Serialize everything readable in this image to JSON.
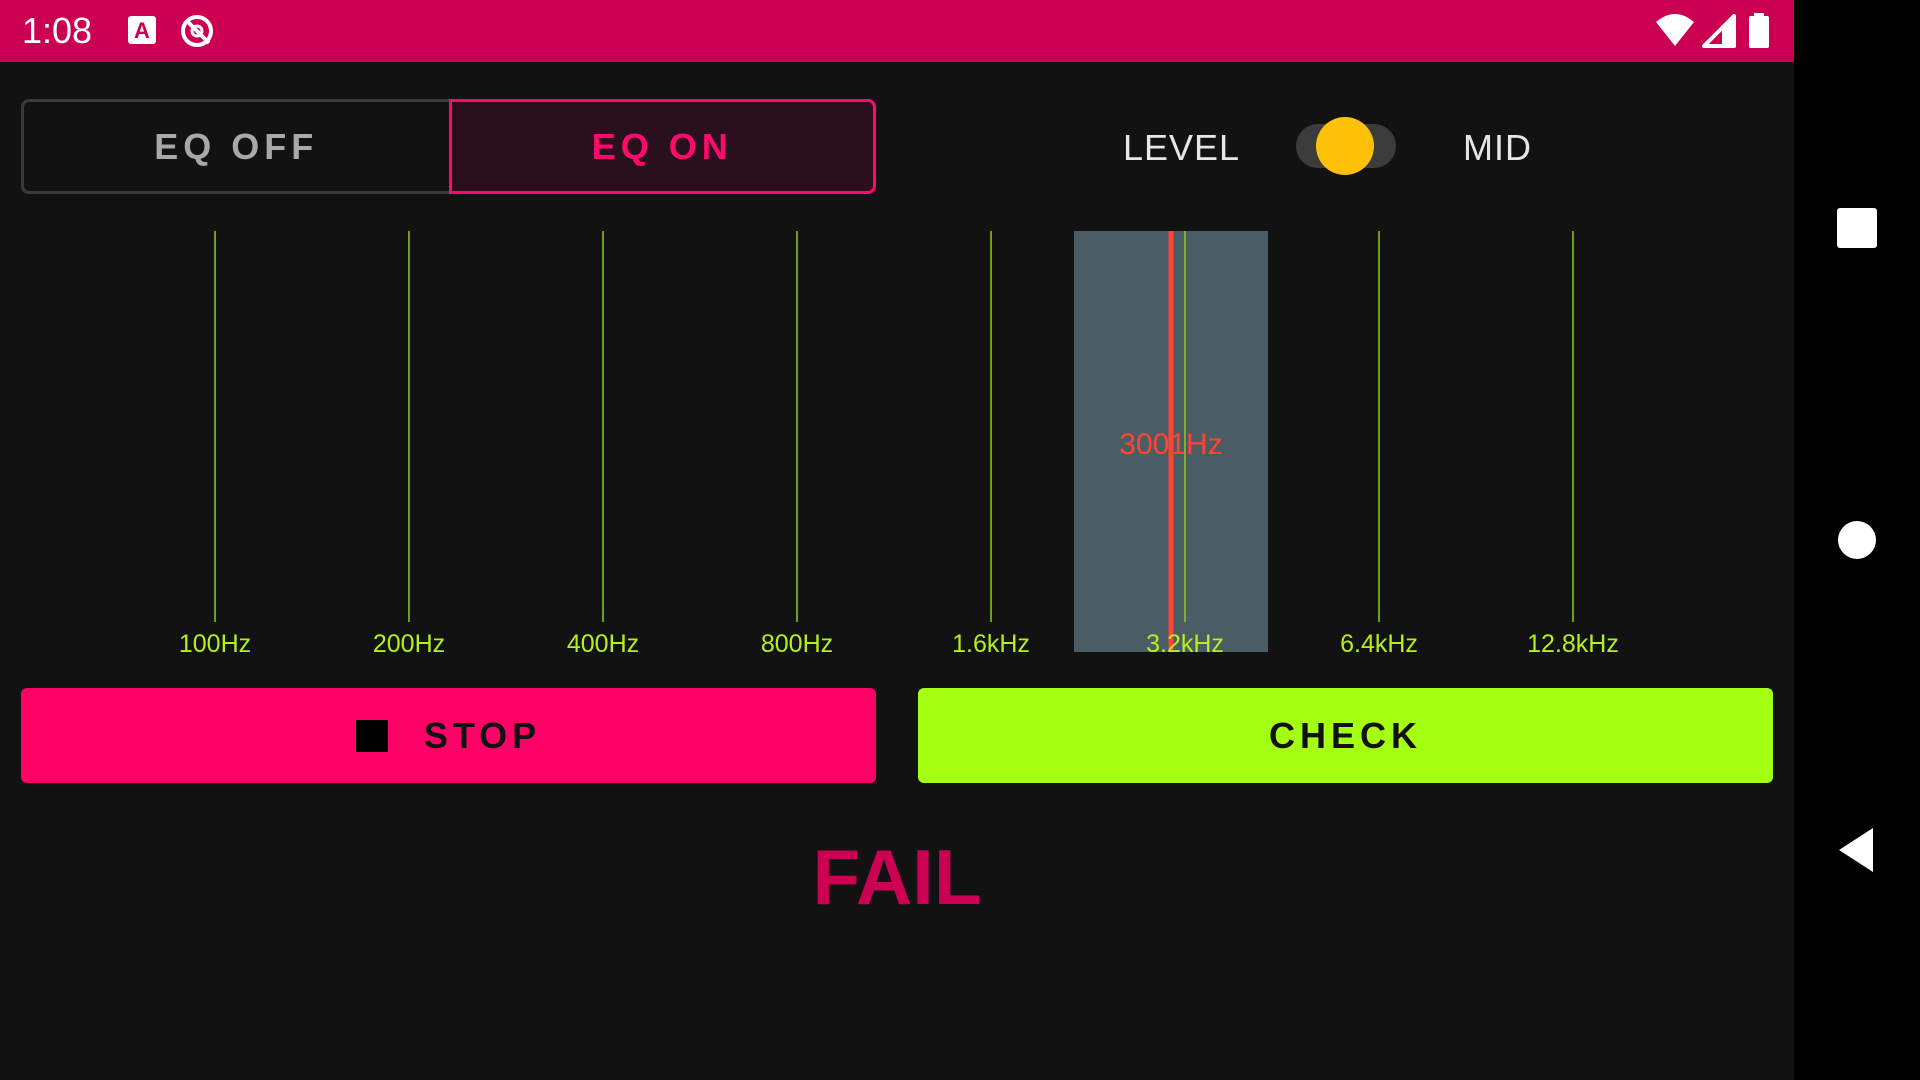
{
  "status_bar": {
    "time": "1:08",
    "left_icons": [
      "translate-a-icon",
      "no-sync-icon"
    ],
    "right_icons": [
      "wifi-icon",
      "cell-signal-icon",
      "battery-icon"
    ],
    "color": "#cc0052"
  },
  "eq_toggle": {
    "off_label": "EQ OFF",
    "on_label": "EQ ON",
    "selected": "EQ ON"
  },
  "level_switch": {
    "left_label": "LEVEL",
    "right_label": "MID",
    "state": "off",
    "thumb_color": "#ffc107"
  },
  "spectrum": {
    "bands": [
      "100Hz",
      "200Hz",
      "400Hz",
      "800Hz",
      "1.6kHz",
      "3.2kHz",
      "6.4kHz",
      "12.8kHz"
    ],
    "highlight_band": "3.2kHz",
    "marker_label": "3001Hz",
    "band_line_color": "#8fcc1a",
    "marker_color": "#ff4433",
    "highlight_color": "#4a5c64"
  },
  "buttons": {
    "stop_label": "STOP",
    "check_label": "CHECK",
    "stop_color": "#ff0066",
    "check_color": "#a4ff12"
  },
  "result": {
    "text": "FAIL",
    "color": "#cc0052"
  },
  "nav_bar": {
    "icons": [
      "recents-square-icon",
      "home-circle-icon",
      "back-triangle-icon"
    ]
  }
}
